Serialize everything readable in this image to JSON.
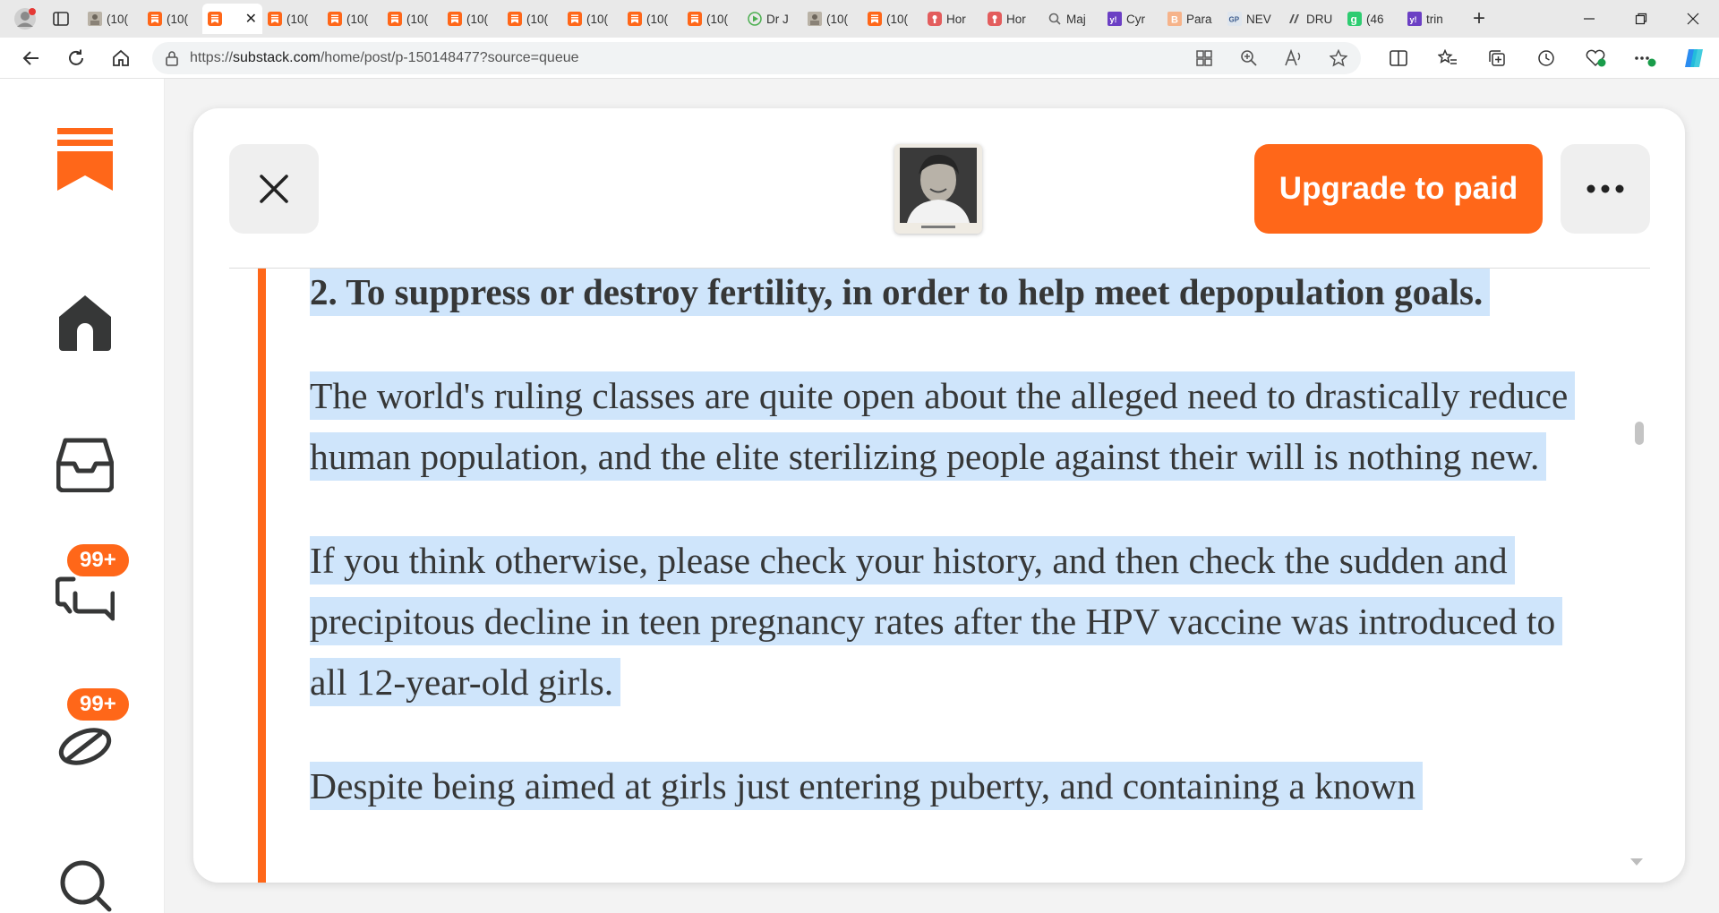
{
  "browser": {
    "tabs": [
      {
        "label": "(10(",
        "favicon": "photo-favicon"
      },
      {
        "label": "(10(",
        "favicon": "substack-favicon"
      },
      {
        "label": "",
        "favicon": "substack-favicon",
        "active": true
      },
      {
        "label": "(10(",
        "favicon": "substack-favicon"
      },
      {
        "label": "(10(",
        "favicon": "substack-favicon"
      },
      {
        "label": "(10(",
        "favicon": "substack-favicon"
      },
      {
        "label": "(10(",
        "favicon": "substack-favicon"
      },
      {
        "label": "(10(",
        "favicon": "substack-favicon"
      },
      {
        "label": "(10(",
        "favicon": "substack-favicon"
      },
      {
        "label": "(10(",
        "favicon": "substack-favicon"
      },
      {
        "label": "(10(",
        "favicon": "substack-favicon"
      },
      {
        "label": "Dr J",
        "favicon": "play-favicon"
      },
      {
        "label": "(10(",
        "favicon": "photo-favicon"
      },
      {
        "label": "(10(",
        "favicon": "substack-favicon"
      },
      {
        "label": "Hor",
        "favicon": "red-favicon"
      },
      {
        "label": "Hor",
        "favicon": "red-favicon"
      },
      {
        "label": "Maj",
        "favicon": "search-favicon"
      },
      {
        "label": "Cyr",
        "favicon": "yahoo-favicon"
      },
      {
        "label": "Para",
        "favicon": "b-favicon"
      },
      {
        "label": "NEV",
        "favicon": "gp-favicon"
      },
      {
        "label": "DRU",
        "favicon": "dr-favicon"
      },
      {
        "label": "(46",
        "favicon": "g-favicon"
      },
      {
        "label": "trin",
        "favicon": "yahoo-favicon"
      }
    ],
    "url_prefix": "https://",
    "url_domain": "substack.com",
    "url_path": "/home/post/p-150148477?source=queue",
    "accent": "#ff6719"
  },
  "sidebar": {
    "chat_badge": "99+",
    "activity_badge": "99+"
  },
  "post": {
    "upgrade_label": "Upgrade to paid",
    "heading": "2. To suppress or destroy fertility, in order to help meet depopulation goals.",
    "paragraphs": [
      "The world's ruling classes are quite open about the alleged need to drastically reduce human population, and the elite sterilizing people against their will is nothing new.",
      "If you think otherwise, please check your history, and then check the sudden and precipitous decline in teen pregnancy rates after the HPV vaccine was introduced to all 12-year-old girls.",
      "Despite being aimed at girls just entering puberty, and containing a known"
    ],
    "highlight_color": "#cfe5fb"
  }
}
